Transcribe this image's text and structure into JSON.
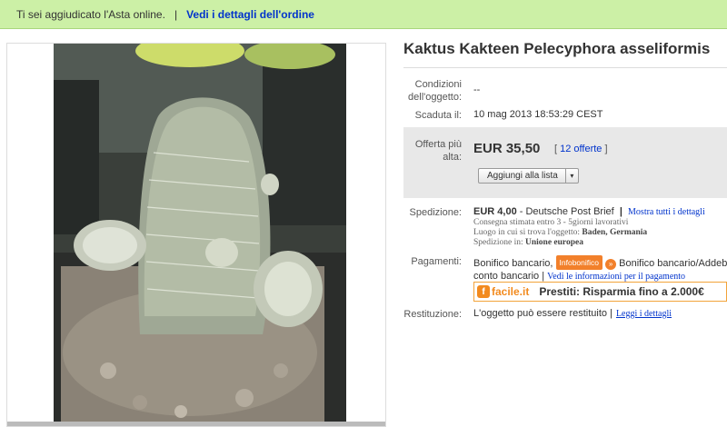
{
  "notice": {
    "message": "Ti sei aggiudicato l'Asta online.",
    "separator": "|",
    "link": "Vedi i dettagli dell'ordine"
  },
  "item": {
    "title": "Kaktus Kakteen Pelecyphora asseliformis"
  },
  "condition": {
    "label": "Condizioni dell'oggetto:",
    "value": "--"
  },
  "ended": {
    "label": "Scaduta il:",
    "value": "10 mag 2013 18:53:29 CEST"
  },
  "bid": {
    "label": "Offerta più alta:",
    "price": "EUR 35,50",
    "bracket_open": "[",
    "offers_link": "12 offerte",
    "bracket_close": "]",
    "watch_button": "Aggiungi alla lista",
    "watch_arrow": "▾"
  },
  "shipping": {
    "label": "Spedizione:",
    "cost": "EUR 4,00",
    "service": " - Deutsche Post Brief",
    "sep": "|",
    "all_details": "Mostra tutti i dettagli",
    "delivery": "Consegna stimata entro 3 - 5giorni lavorativi",
    "location_label": "Luogo in cui si trova l'oggetto:",
    "location": "Baden, Germania",
    "ships_to_label": "Spedizione in:",
    "ships_to": "Unione europea"
  },
  "payment": {
    "label": "Pagamenti:",
    "line1_a": "Bonifico bancario,",
    "infobonifico": "Infobonifico",
    "line1_b": " Bonifico bancario/Addebito",
    "line2_a": "conto bancario | ",
    "info_link": "Vedi le informazioni per il pagamento"
  },
  "facile": {
    "logo_letter": "f",
    "logo_text": "facile.it",
    "promo": "Prestiti: Risparmia fino a 2.000€"
  },
  "returns": {
    "label": "Restituzione:",
    "value": "L'oggetto può essere restituito |",
    "link": "Leggi i dettagli"
  },
  "colors": {
    "notice_bg": "#ccf0a6",
    "link": "#0033cc",
    "bidbox_bg": "#e8e8e8",
    "facile_orange": "#f28a1e"
  }
}
